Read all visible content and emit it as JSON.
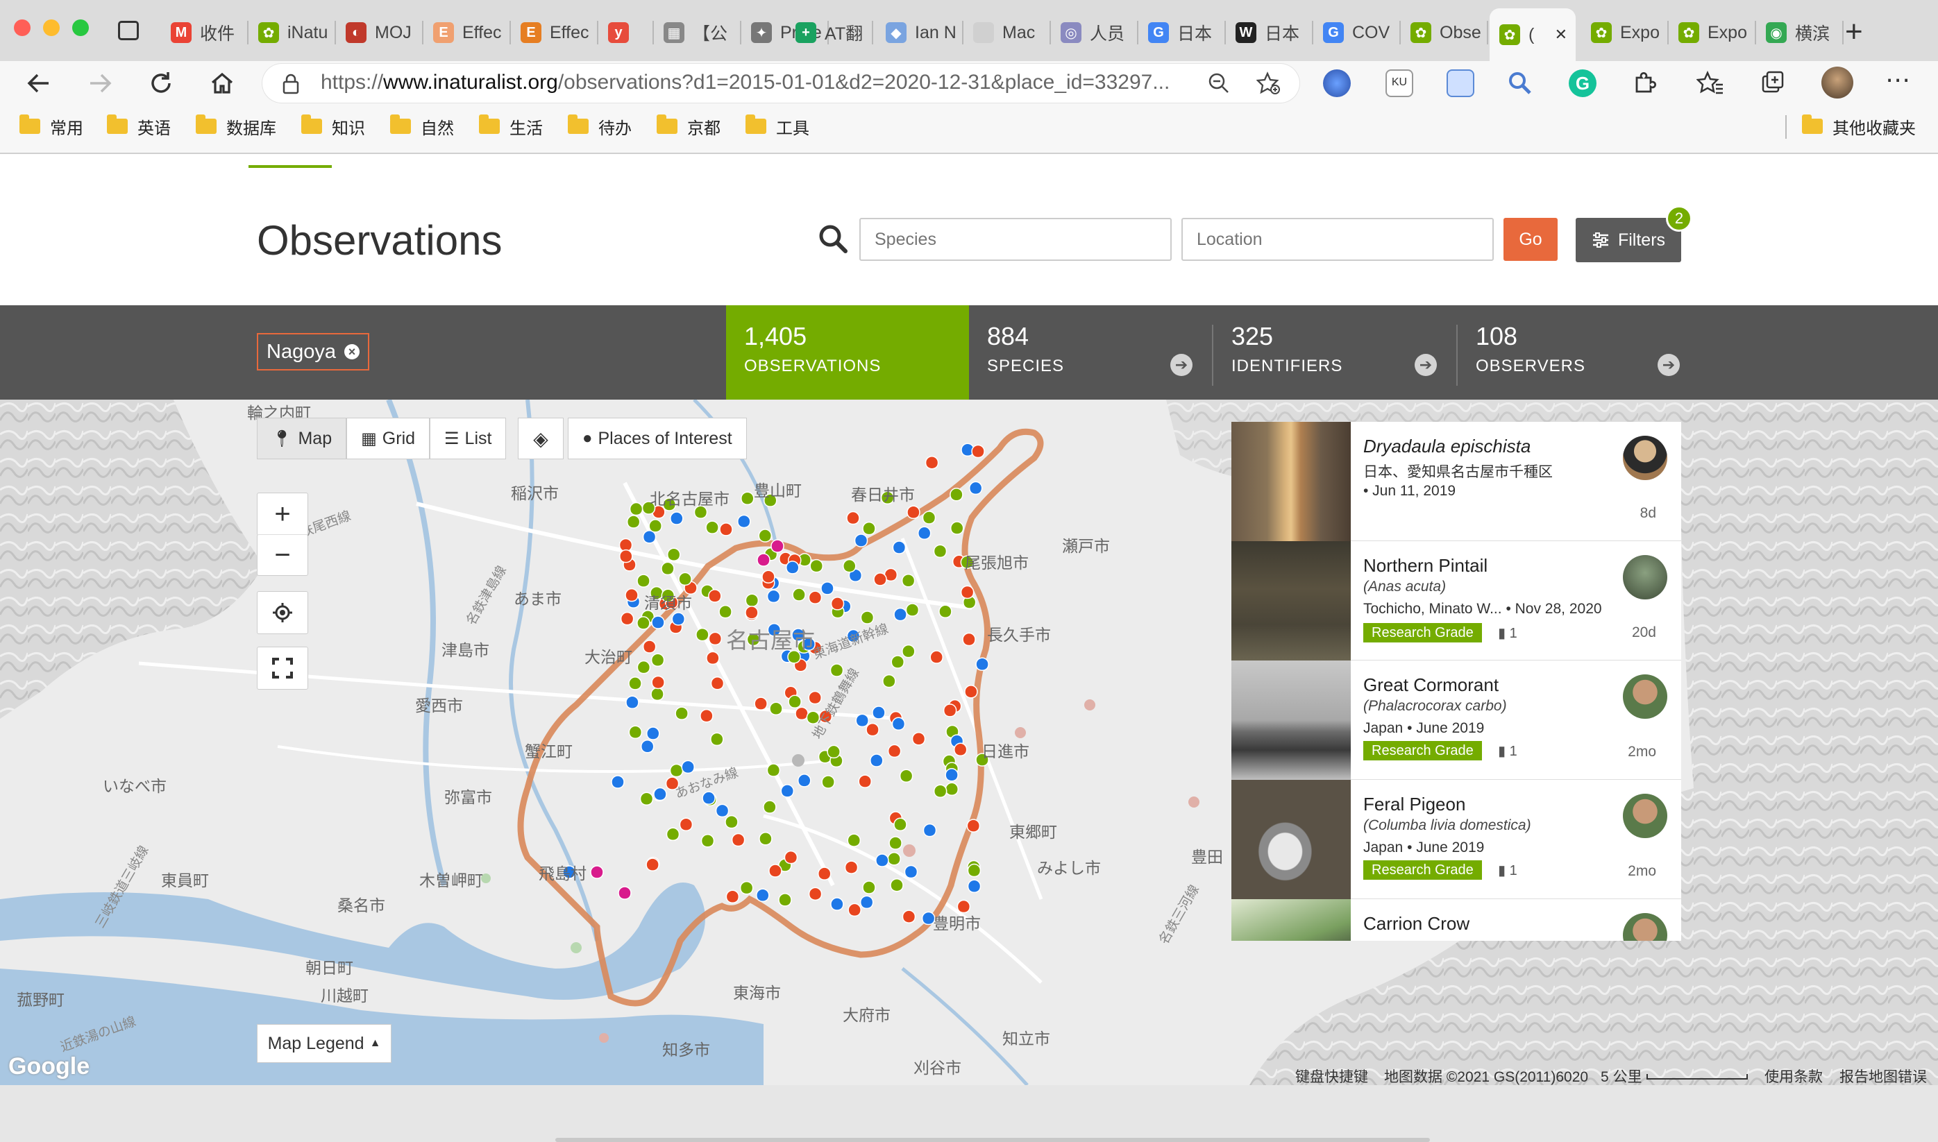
{
  "browser": {
    "tabs": [
      {
        "label": "收件",
        "color": "#ea4335",
        "glyph": "M"
      },
      {
        "label": "iNatu",
        "color": "#74ac00",
        "glyph": "✿"
      },
      {
        "label": "MOJ",
        "color": "#c0392b",
        "glyph": "◐"
      },
      {
        "label": "Effec",
        "color": "#f0a070",
        "glyph": "E"
      },
      {
        "label": "Effec",
        "color": "#e67e22",
        "glyph": "E"
      },
      {
        "label": "",
        "color": "#e74c3c",
        "glyph": "y"
      },
      {
        "label": "【公",
        "color": "#888888",
        "glyph": "▦"
      },
      {
        "label": "Profe",
        "color": "#777777",
        "glyph": "✦"
      },
      {
        "label": "AT翻",
        "color": "#1aa260",
        "glyph": "+"
      },
      {
        "label": "Ian N",
        "color": "#7aa4e0",
        "glyph": "◆"
      },
      {
        "label": "Mac",
        "color": "#d0d0d0",
        "glyph": ""
      },
      {
        "label": "人员",
        "color": "#8a8ac0",
        "glyph": "◎"
      },
      {
        "label": "日本",
        "color": "#4285f4",
        "glyph": "G"
      },
      {
        "label": "日本",
        "color": "#222222",
        "glyph": "W"
      },
      {
        "label": "COV",
        "color": "#4285f4",
        "glyph": "G"
      },
      {
        "label": "Obse",
        "color": "#74ac00",
        "glyph": "✿"
      },
      {
        "label": "(",
        "color": "#74ac00",
        "glyph": "✿"
      },
      {
        "label": "Expo",
        "color": "#74ac00",
        "glyph": "✿"
      },
      {
        "label": "Expo",
        "color": "#74ac00",
        "glyph": "✿"
      },
      {
        "label": "横滨",
        "color": "#34a853",
        "glyph": "◉"
      }
    ],
    "active_tab_index": 16,
    "url_prefix": "https://",
    "url_host": "www.inaturalist.org",
    "url_path": "/observations?d1=2015-01-01&d2=2020-12-31&place_id=33297...",
    "bookmarks": [
      "常用",
      "英语",
      "数据库",
      "知识",
      "自然",
      "生活",
      "待办",
      "京都",
      "工具"
    ],
    "other_bookmarks": "其他收藏夹"
  },
  "header": {
    "title": "Observations",
    "species_placeholder": "Species",
    "location_placeholder": "Location",
    "go_label": "Go",
    "filters_label": "Filters",
    "filters_count": "2"
  },
  "stats": {
    "place": "Nagoya",
    "items": [
      {
        "num": "1,405",
        "label": "OBSERVATIONS"
      },
      {
        "num": "884",
        "label": "SPECIES"
      },
      {
        "num": "325",
        "label": "IDENTIFIERS"
      },
      {
        "num": "108",
        "label": "OBSERVERS"
      }
    ]
  },
  "map": {
    "view_buttons": [
      "Map",
      "Grid",
      "List"
    ],
    "places_button": "Places of Interest",
    "legend_button": "Map Legend",
    "labels": [
      "輪之内町",
      "稲沢市",
      "北名古屋市",
      "豊山町",
      "春日井市",
      "瀬戸市",
      "尾張旭市",
      "長久手市",
      "あま市",
      "清須市",
      "名古屋市",
      "津島市",
      "大治町",
      "愛西市",
      "蟹江町",
      "日進市",
      "弥富市",
      "いなべ市",
      "東郷町",
      "みよし市",
      "豊田",
      "木曽岬町",
      "飛島村",
      "桑名市",
      "東員町",
      "朝日町",
      "川越町",
      "菰野町",
      "東海市",
      "大府市",
      "豊明市",
      "知多市",
      "知立市",
      "刈谷市",
      "名鉄尾西線",
      "名鉄津島線",
      "東海道新幹線",
      "三岐鉄道三岐線",
      "近鉄湯の山線",
      "名鉄三河線",
      "あおなみ線",
      "地下鉄鶴舞線"
    ],
    "attribution": "键盘快捷键",
    "map_data": "地图数据 ©2021 GS(2011)6020",
    "scale": "5 公里",
    "terms": "使用条款",
    "report": "报告地图错误",
    "google": "Google"
  },
  "observations": [
    {
      "name": "Dryadaula epischista",
      "scientific_only": true,
      "sub": "",
      "place": "日本、愛知県名古屋市千種区",
      "date": "• Jun 11, 2019",
      "grade": "",
      "ids": "",
      "ago": "8d"
    },
    {
      "name": "Northern Pintail",
      "scientific_only": false,
      "sub": "(Anas acuta)",
      "place": "Tochicho, Minato W...",
      "date": "• Nov 28, 2020",
      "grade": "Research Grade",
      "ids": "1",
      "ago": "20d"
    },
    {
      "name": "Great Cormorant",
      "scientific_only": false,
      "sub": "(Phalacrocorax carbo)",
      "place": "Japan",
      "date": "• June 2019",
      "grade": "Research Grade",
      "ids": "1",
      "ago": "2mo"
    },
    {
      "name": "Feral Pigeon",
      "scientific_only": false,
      "sub": "(Columba livia domestica)",
      "place": "Japan",
      "date": "• June 2019",
      "grade": "Research Grade",
      "ids": "1",
      "ago": "2mo"
    },
    {
      "name": "Carrion Crow",
      "scientific_only": false,
      "sub": "",
      "place": "",
      "date": "",
      "grade": "",
      "ids": "",
      "ago": ""
    }
  ],
  "colors": {
    "brand_green": "#74ac00",
    "go_orange": "#e8693c",
    "stats_bg": "#555555",
    "boundary": "#d9885a"
  }
}
